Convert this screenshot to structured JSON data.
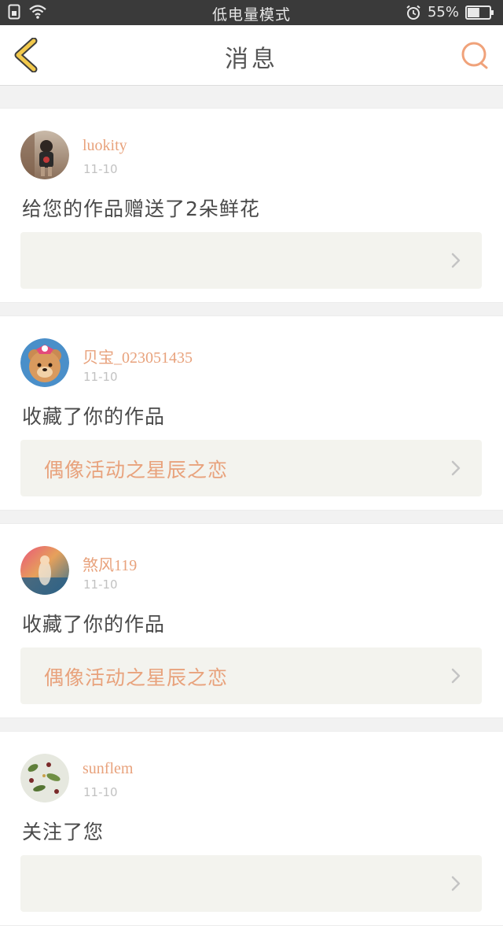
{
  "status_bar": {
    "mode_text": "低电量模式",
    "battery_percent": "55%",
    "battery_level": 0.55,
    "icons": [
      "sim-icon",
      "wifi-icon",
      "alarm-icon",
      "battery-icon"
    ]
  },
  "header": {
    "title": "消息",
    "back_icon": "chevron-left-icon",
    "search_icon": "search-icon"
  },
  "colors": {
    "accent": "#e8a27c",
    "back_arrow": "#f2c94c",
    "status_bar_bg": "#3a3a3a",
    "page_bg": "#f2f2f2",
    "link_bg": "#f3f3ee"
  },
  "messages": [
    {
      "username": "luokity",
      "date": "11-10",
      "text": "给您的作品赠送了2朵鲜花",
      "work_title": ""
    },
    {
      "username": "贝宝_023051435",
      "date": "11-10",
      "text": "收藏了你的作品",
      "work_title": "偶像活动之星辰之恋"
    },
    {
      "username": "煞风119",
      "date": "11-10",
      "text": "收藏了你的作品",
      "work_title": "偶像活动之星辰之恋"
    },
    {
      "username": "sunflem",
      "date": "11-10",
      "text": "关注了您",
      "work_title": ""
    }
  ]
}
